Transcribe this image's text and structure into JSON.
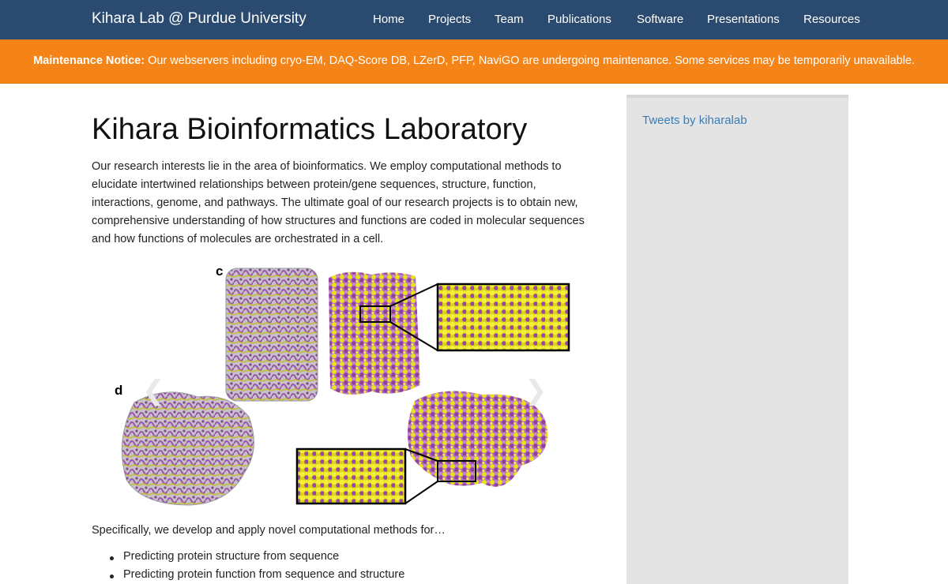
{
  "navbar": {
    "brand": "Kihara Lab @ Purdue University",
    "items": [
      "Home",
      "Projects",
      "Team",
      "Publications",
      "Software",
      "Presentations",
      "Resources"
    ]
  },
  "notice": {
    "label": "Maintenance Notice:",
    "text": " Our webservers including cryo-EM, DAQ-Score DB, LZerD, PFP, NaviGO are undergoing maintenance. Some services may be temporarily unavailable."
  },
  "main": {
    "title": "Kihara Bioinformatics Laboratory",
    "intro": "Our research interests lie in the area of bioinformatics. We employ computational methods to elucidate intertwined relationships between protein/gene sequences, structure, function, interactions, genome, and pathways. The ultimate goal of our research projects is to obtain new, comprehensive understanding of how structures and functions are coded in molecular sequences and how functions of molecules are orchestrated in a cell.",
    "figure": {
      "panel_c": "c",
      "panel_d": "d"
    },
    "specifically": "Specifically, we develop and apply novel computational methods for…",
    "list": [
      "Predicting protein structure from sequence",
      "Predicting protein function from sequence and structure"
    ]
  },
  "sidebar": {
    "tweets_link": "Tweets by kiharalab"
  },
  "colors": {
    "navbar": "#2b4a6f",
    "notice": "#f58418",
    "link": "#3a7db8",
    "sidebar": "#e4e4e4",
    "purple": "#9b4fa8",
    "yellow": "#e8e21a"
  }
}
